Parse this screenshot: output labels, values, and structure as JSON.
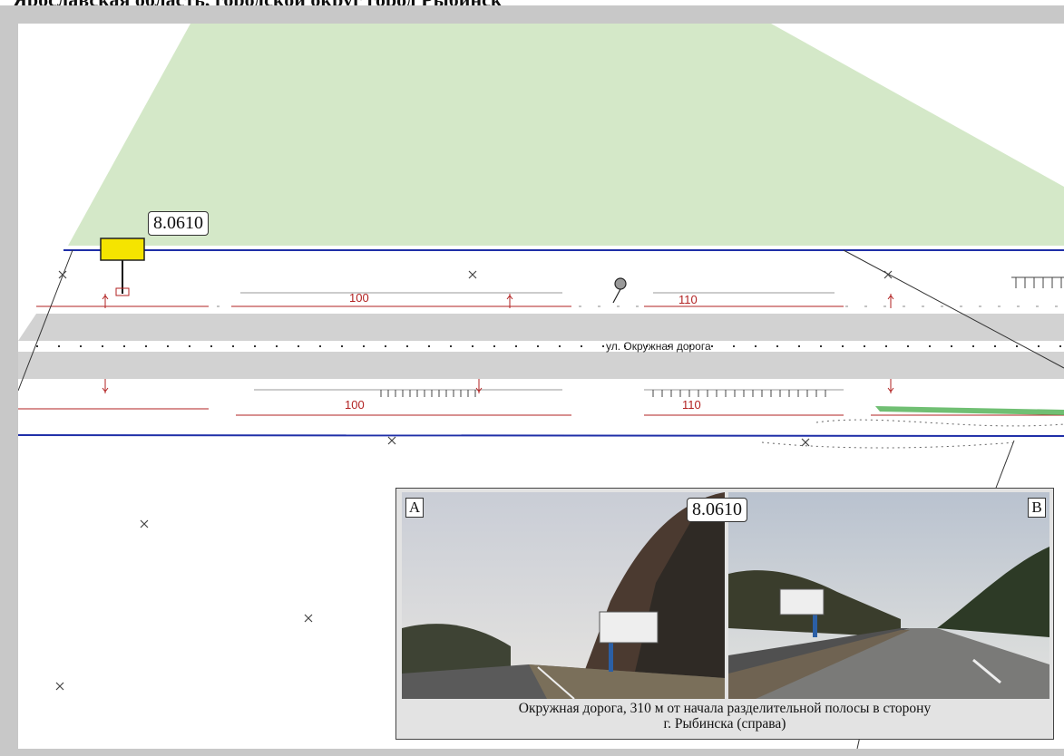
{
  "header": {
    "title": "Ярославская область, городской округ город Рыбинск"
  },
  "map": {
    "billboard_code": "8.0610",
    "street_label": "ул. Окружная дорога",
    "distances": [
      {
        "label": "100"
      },
      {
        "label": "110"
      },
      {
        "label": "100"
      },
      {
        "label": "110"
      }
    ]
  },
  "photo_panel": {
    "code": "8.0610",
    "photo_a": {
      "letter": "A"
    },
    "photo_b": {
      "letter": "B"
    },
    "caption_line1": "Окружная дорога, 310 м от начала разделительной полосы в сторону",
    "caption_line2": "г. Рыбинска (справа)"
  },
  "colors": {
    "view_cone": "#cfe5c2",
    "road_edge": "#1f2fa8",
    "dimension": "#b22222",
    "billboard_marker": "#f5e400",
    "road_band": "#d2d2d2"
  }
}
